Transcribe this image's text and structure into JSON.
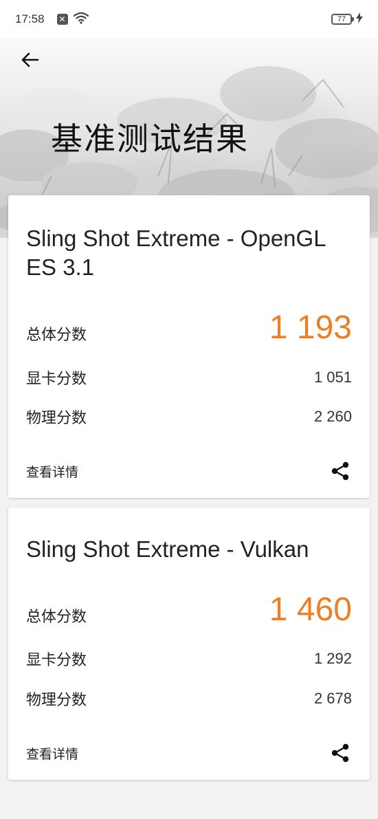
{
  "status_bar": {
    "time": "17:58",
    "notification_icon": "x-badge-icon",
    "wifi_icon": "wifi-icon",
    "battery_level": "77",
    "charging_icon": "lightning-icon"
  },
  "header": {
    "title": "基准测试结果",
    "back_icon": "arrow-left-icon"
  },
  "results": [
    {
      "title": "Sling Shot Extreme - OpenGL ES 3.1",
      "total_label": "总体分数",
      "total_value": "1 193",
      "graphics_label": "显卡分数",
      "graphics_value": "1 051",
      "physics_label": "物理分数",
      "physics_value": "2 260",
      "details_label": "查看详情",
      "share_icon": "share-icon"
    },
    {
      "title": "Sling Shot Extreme - Vulkan",
      "total_label": "总体分数",
      "total_value": "1 460",
      "graphics_label": "显卡分数",
      "graphics_value": "1 292",
      "physics_label": "物理分数",
      "physics_value": "2 678",
      "details_label": "查看详情",
      "share_icon": "share-icon"
    }
  ],
  "colors": {
    "accent": "#ef7d24",
    "background": "#f2f2f2",
    "card": "#ffffff"
  }
}
